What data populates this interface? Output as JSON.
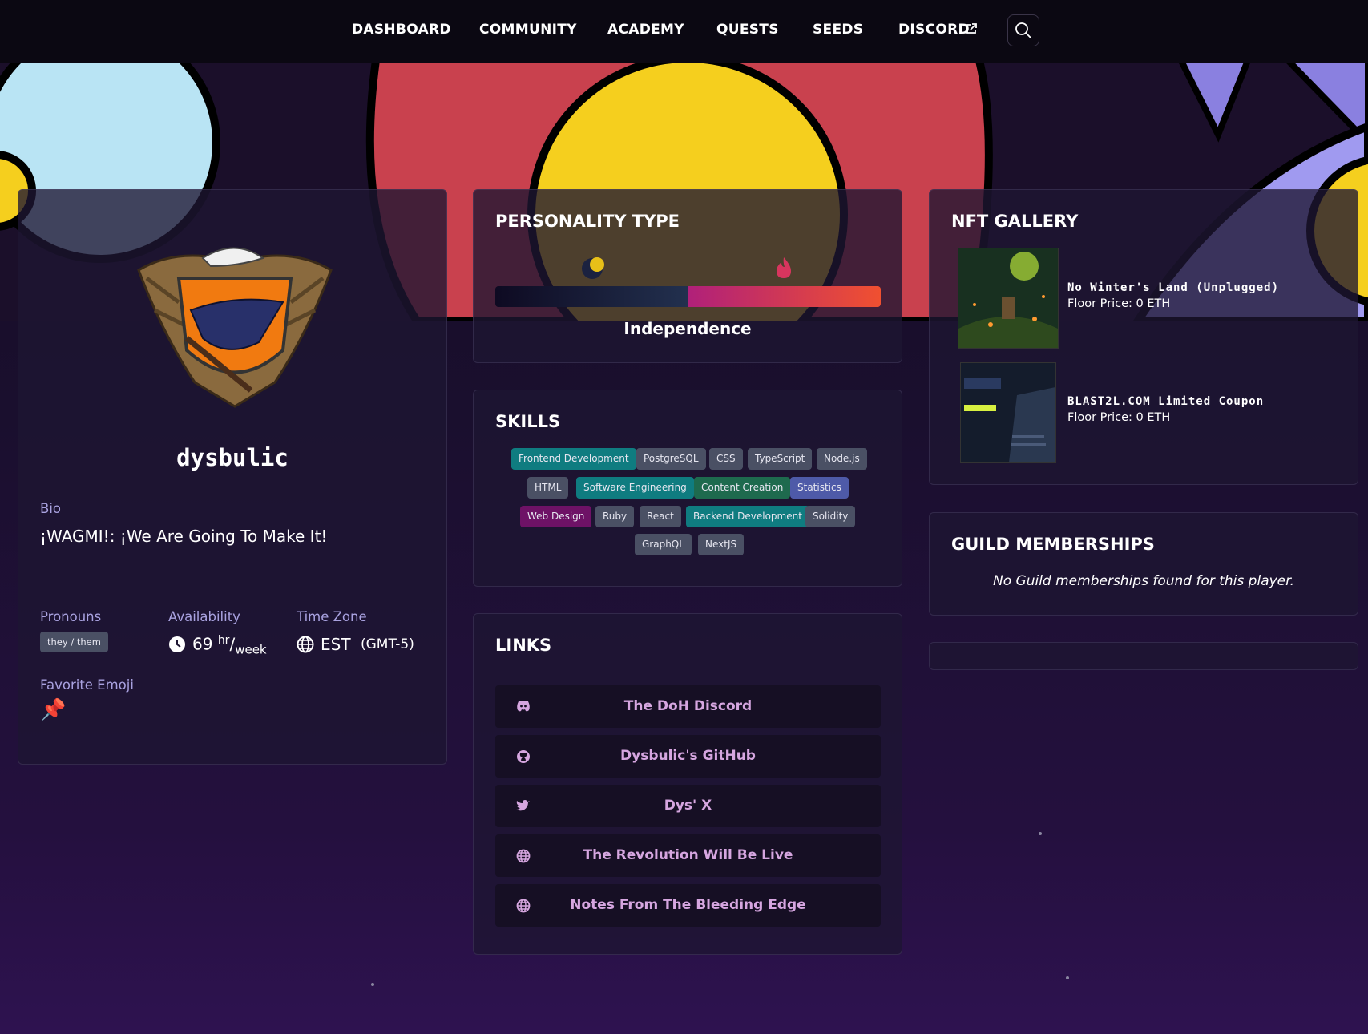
{
  "nav": {
    "items": [
      "DASHBOARD",
      "COMMUNITY",
      "ACADEMY",
      "QUESTS",
      "SEEDS",
      "DISCORD"
    ]
  },
  "profile": {
    "username": "dysbulic",
    "bio_label": "Bio",
    "bio": "¡WAGMI!: ¡We Are Going To Make It!",
    "pronouns_label": "Pronouns",
    "pronouns": "they / them",
    "availability_label": "Availability",
    "availability_value": "69",
    "availability_unit_top": "hr",
    "availability_unit_bottom": "week",
    "timezone_label": "Time Zone",
    "timezone": "EST",
    "timezone_offset": "(GMT-5)",
    "emoji_label": "Favorite Emoji",
    "emoji": "📌"
  },
  "personality": {
    "title": "PERSONALITY TYPE",
    "caption": "Independence"
  },
  "skills": {
    "title": "SKILLS",
    "items": [
      {
        "label": "Frontend Development",
        "color": "#0f7c80"
      },
      {
        "label": "PostgreSQL",
        "color": "#4a5064"
      },
      {
        "label": "CSS",
        "color": "#4a5064"
      },
      {
        "label": "TypeScript",
        "color": "#4a5064"
      },
      {
        "label": "Node.js",
        "color": "#4a5064"
      },
      {
        "label": "HTML",
        "color": "#4a5064"
      },
      {
        "label": "Software Engineering",
        "color": "#0f7c80"
      },
      {
        "label": "Content Creation",
        "color": "#1e6a4e"
      },
      {
        "label": "Statistics",
        "color": "#4e5aa8"
      },
      {
        "label": "Web Design",
        "color": "#6e1266"
      },
      {
        "label": "Ruby",
        "color": "#4a5064"
      },
      {
        "label": "React",
        "color": "#4a5064"
      },
      {
        "label": "Backend Development",
        "color": "#0f7c80"
      },
      {
        "label": "Solidity",
        "color": "#4a5064"
      },
      {
        "label": "GraphQL",
        "color": "#4a5064"
      },
      {
        "label": "NextJS",
        "color": "#4a5064"
      }
    ]
  },
  "links": {
    "title": "LINKS",
    "items": [
      {
        "label": "The DoH Discord",
        "icon": "discord-icon"
      },
      {
        "label": "Dysbulic's GitHub",
        "icon": "github-icon"
      },
      {
        "label": "Dys' X",
        "icon": "twitter-icon"
      },
      {
        "label": "The Revolution Will Be Live",
        "icon": "globe-icon"
      },
      {
        "label": "Notes From The Bleeding Edge",
        "icon": "globe-icon"
      }
    ]
  },
  "nft": {
    "title": "NFT GALLERY",
    "items": [
      {
        "name": "No Winter's Land (Unplugged)",
        "price": "Floor Price: 0 ETH"
      },
      {
        "name": "BLAST2L.COM Limited Coupon",
        "price": "Floor Price: 0 ETH"
      }
    ]
  },
  "guild": {
    "title": "GUILD MEMBERSHIPS",
    "empty": "No Guild memberships found for this player."
  }
}
